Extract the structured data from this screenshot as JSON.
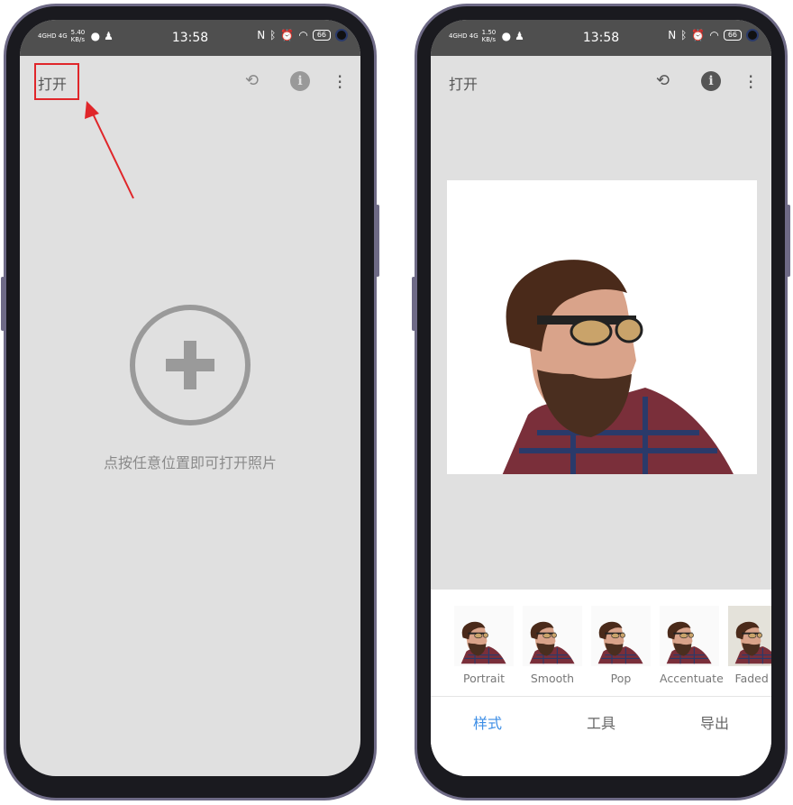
{
  "left_phone": {
    "status": {
      "network": "4GHD 4G",
      "speed": "5.40 KB/s",
      "time": "13:58",
      "battery": "66"
    },
    "topbar": {
      "open_label": "打开",
      "icons": [
        "layers-rotate-icon",
        "info-icon",
        "more-vert-icon"
      ]
    },
    "empty_hint": "点按任意位置即可打开照片",
    "annotation": {
      "highlight_color": "#e0262a",
      "arrow_color": "#e0262a"
    }
  },
  "right_phone": {
    "status": {
      "network": "4GHD 4G",
      "speed": "1.50 KB/s",
      "time": "13:58",
      "battery": "66"
    },
    "topbar": {
      "open_label": "打开"
    },
    "styles": [
      {
        "label": "Portrait"
      },
      {
        "label": "Smooth"
      },
      {
        "label": "Pop"
      },
      {
        "label": "Accentuate"
      },
      {
        "label": "Faded G"
      }
    ],
    "tabs": [
      {
        "label": "样式",
        "active": true
      },
      {
        "label": "工具"
      },
      {
        "label": "导出"
      }
    ],
    "accent": "#3d8ee6"
  }
}
